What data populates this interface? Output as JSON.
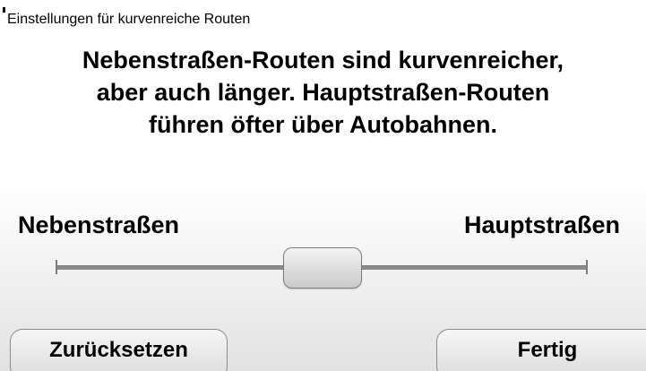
{
  "screen": {
    "title": "Einstellungen für kurvenreiche Routen",
    "description_lines": [
      "Nebenstraßen-Routen sind kurvenreicher,",
      "aber auch länger. Hauptstraßen-Routen",
      "führen öfter über Autobahnen."
    ]
  },
  "slider": {
    "min_label": "Nebenstraßen",
    "max_label": "Hauptstraßen",
    "value": 0.5
  },
  "buttons": {
    "reset_label": "Zurücksetzen",
    "done_label": "Fertig"
  },
  "colors": {
    "text": "#000000",
    "track": "#8a8a8a",
    "thumb": "#dcdcdc"
  }
}
